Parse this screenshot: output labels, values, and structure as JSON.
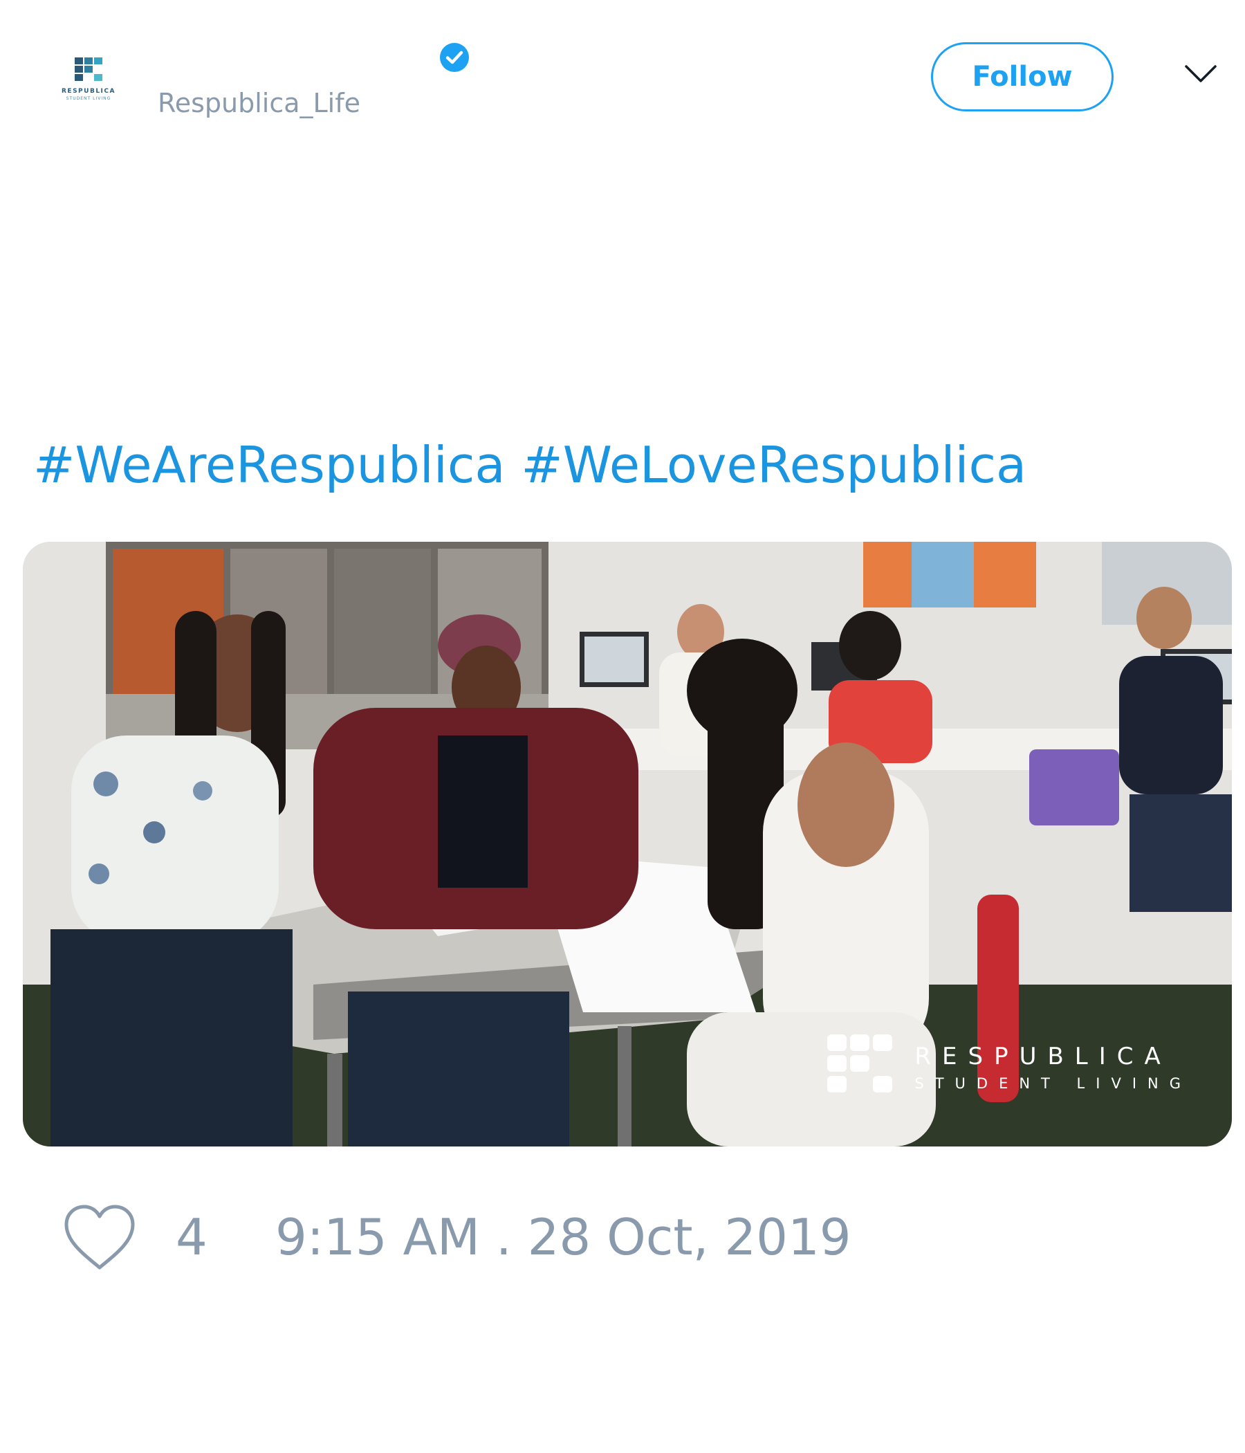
{
  "tweet": {
    "author": {
      "handle": "Respublica_Life",
      "avatar_logo_text": "RESPUBLICA",
      "avatar_logo_subtext": "STUDENT LIVING",
      "verified_icon": "verified-badge-icon"
    },
    "follow_label": "Follow",
    "menu_icon": "chevron-down-icon",
    "text": {
      "hashtags": [
        "#WeAreRespublica",
        "#WeLoveRespublica"
      ]
    },
    "media": {
      "watermark_name": "RESPUBLICA",
      "watermark_sub": "STUDENT LIVING"
    },
    "likes": {
      "icon": "heart-icon",
      "count": "4"
    },
    "timestamp": "9:15 AM . 28 Oct, 2019"
  },
  "colors": {
    "accent": "#1da1f2",
    "hashtag": "#1b95e0",
    "muted_text": "#8a9aad"
  }
}
